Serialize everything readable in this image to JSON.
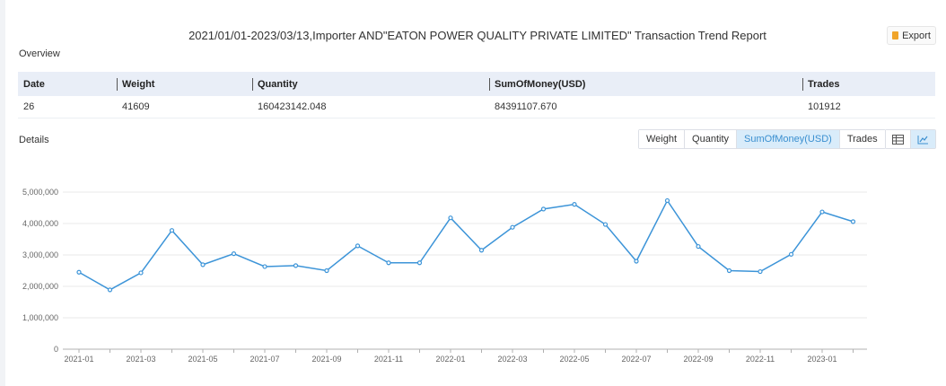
{
  "header": {
    "title": "2021/01/01-2023/03/13,Importer AND\"EATON POWER QUALITY PRIVATE LIMITED\" Transaction Trend Report",
    "export_label": "Export"
  },
  "overview": {
    "label": "Overview",
    "columns": [
      "Date",
      "Weight",
      "Quantity",
      "SumOfMoney(USD)",
      "Trades"
    ],
    "row": [
      "26",
      "41609",
      "160423142.048",
      "84391107.670",
      "101912"
    ]
  },
  "details": {
    "label": "Details",
    "tabs": [
      "Weight",
      "Quantity",
      "SumOfMoney(USD)",
      "Trades"
    ],
    "active_tab": "SumOfMoney(USD)",
    "view_icons": [
      "table-view-icon",
      "line-chart-view-icon"
    ],
    "active_view": "line-chart-view-icon"
  },
  "colors": {
    "line": "#3c94d8",
    "active_tab_bg": "#d9ecfa",
    "header_bg": "#e9eef7"
  },
  "chart_data": {
    "type": "line",
    "x": [
      "2021-01",
      "2021-02",
      "2021-03",
      "2021-04",
      "2021-05",
      "2021-06",
      "2021-07",
      "2021-08",
      "2021-09",
      "2021-10",
      "2021-11",
      "2021-12",
      "2022-01",
      "2022-02",
      "2022-03",
      "2022-04",
      "2022-05",
      "2022-06",
      "2022-07",
      "2022-08",
      "2022-09",
      "2022-10",
      "2022-11",
      "2022-12",
      "2023-01",
      "2023-02"
    ],
    "x_tick_labels": [
      "2021-01",
      "2021-03",
      "2021-05",
      "2021-07",
      "2021-09",
      "2021-11",
      "2022-01",
      "2022-03",
      "2022-05",
      "2022-07",
      "2022-09",
      "2022-11",
      "2023-01"
    ],
    "series": [
      {
        "values": [
          2450000,
          1890000,
          2430000,
          3780000,
          2690000,
          3040000,
          2630000,
          2660000,
          2500000,
          3290000,
          2750000,
          2750000,
          4180000,
          3150000,
          3880000,
          4460000,
          4610000,
          3970000,
          2800000,
          4730000,
          3270000,
          2500000,
          2470000,
          3020000,
          4370000,
          4060000
        ]
      }
    ],
    "y_tick_labels": [
      "0",
      "1,000,000",
      "2,000,000",
      "3,000,000",
      "4,000,000",
      "5,000,000"
    ],
    "ylim": [
      0,
      5000000
    ],
    "grid": true,
    "legend": "none",
    "title": "",
    "xlabel": "",
    "ylabel": ""
  }
}
